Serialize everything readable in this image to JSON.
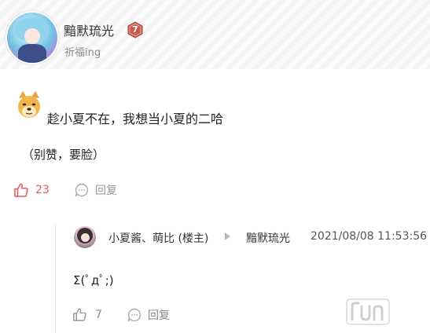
{
  "header": {
    "username": "黯默琉光",
    "level": "7",
    "signature": "祈福ing"
  },
  "comment": {
    "text": "趁小夏不在，我想当小夏的二哈",
    "note": "（别赞，要脸）",
    "like_count": "23",
    "reply_label": "回复"
  },
  "reply": {
    "author": "小夏酱、萌比 (楼主)",
    "target": "黯默琉光",
    "timestamp": "2021/08/08 11:53:56",
    "text": "Σ(ﾟдﾟ;)",
    "like_count": "7",
    "reply_label": "回复"
  },
  "icons": {
    "level_badge": "level-hexagon-icon",
    "emoji": "doge-emoji-icon",
    "like": "thumbs-up-icon",
    "reply": "speech-bubble-icon",
    "arrow": "triangle-right-icon"
  },
  "colors": {
    "like_active": "#e05a5a",
    "level_badge": "#c25a4e",
    "muted_text": "#999999"
  }
}
